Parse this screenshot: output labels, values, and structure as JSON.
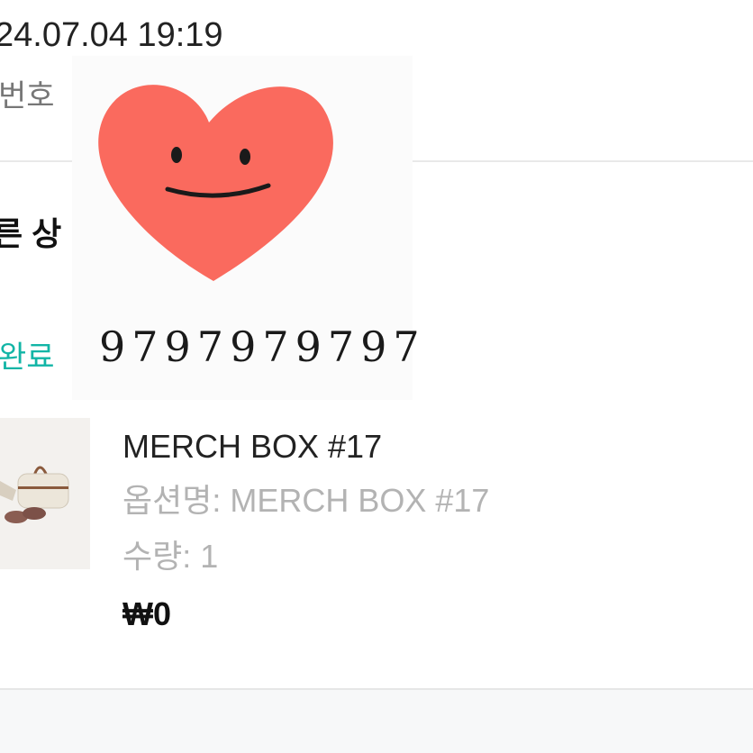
{
  "order": {
    "date": "24.07.04 19:19",
    "number_label": "번호"
  },
  "section": {
    "title": "른 상",
    "status": "완료"
  },
  "sticker": {
    "number": "9797979797",
    "heart_color": "#fa6a5e"
  },
  "product": {
    "name": "MERCH BOX #17",
    "option": "옵션명: MERCH BOX #17",
    "quantity": "수량: 1",
    "price": "₩0"
  },
  "colors": {
    "status": "#12b5a6",
    "muted_text": "#b3b3b3"
  }
}
